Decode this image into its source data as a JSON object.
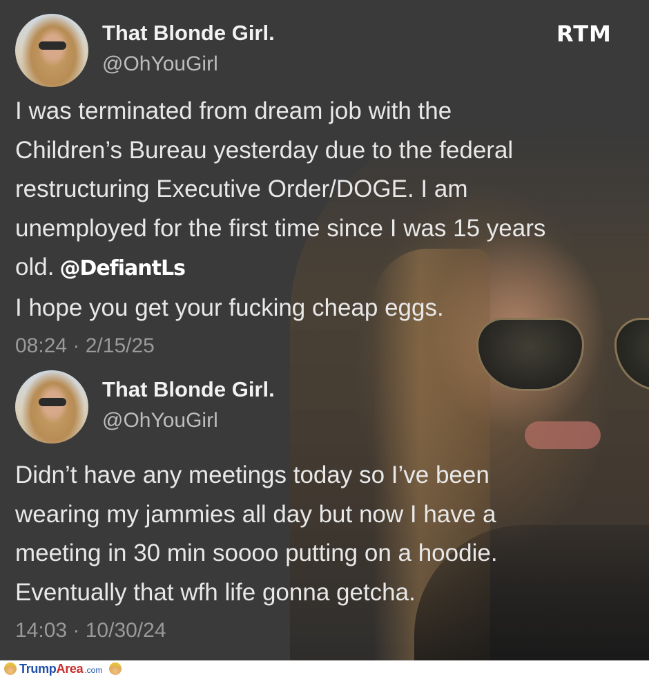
{
  "watermark_top": "RTM",
  "tweets": [
    {
      "name": "That Blonde Girl.",
      "handle": "@OhYouGirl",
      "body": "I was terminated from dream job with the\nChildren’s Bureau yesterday due to the federal\nrestructuring Executive Order/DOGE. I am\nunemployed for the first time since I was 15 years\nold.",
      "mention": "@DefiantLs",
      "body_after": "I hope you get your fucking cheap eggs.",
      "meta": "08:24 · 2/15/25"
    },
    {
      "name": "That Blonde Girl.",
      "handle": "@OhYouGirl",
      "body": "Didn’t have any meetings today so I’ve been\nwearing my jammies all day but now I have a\nmeeting in 30 min soooo putting on a hoodie.\nEventually that wfh life gonna getcha.",
      "meta": "14:03 · 10/30/24"
    }
  ],
  "footer": {
    "site_part1": "Trump",
    "site_part2": "Area",
    "site_suffix": ".com"
  },
  "colors": {
    "background": "#3a3a3a",
    "text": "#e8e8e8",
    "meta": "#9a9a9a",
    "footer_blue": "#1f4fa8",
    "footer_red": "#c92a2a"
  }
}
